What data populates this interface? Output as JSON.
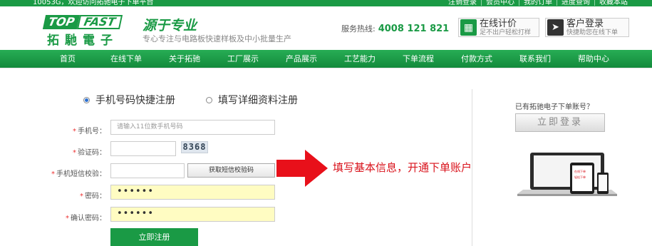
{
  "topbar": {
    "welcome": "10053G，欢迎访问拓驰电子下单平台",
    "links": [
      "注销登录",
      "会员中心",
      "我的订单",
      "进度查询",
      "收藏本站"
    ]
  },
  "header": {
    "logo_top": "TOP",
    "logo_fast": "FAST",
    "logo_cn": "拓馳電子",
    "slogan": "源于专业",
    "tagline": "专心专注与电路板快速样板及中小批量生产",
    "hotline_label": "服务热线:",
    "hotline_number": "4008 121 821",
    "calc_title": "在线计价",
    "calc_sub": "足不出户轻松打样",
    "login_title": "客户登录",
    "login_sub": "快捷助您在线下单",
    "calc_icon": "calculator-icon",
    "login_icon": "cursor-icon"
  },
  "nav": [
    "首页",
    "在线下单",
    "关于拓驰",
    "工厂展示",
    "产品展示",
    "工艺能力",
    "下单流程",
    "付款方式",
    "联系我们",
    "帮助中心"
  ],
  "form": {
    "radio_quick": "手机号码快捷注册",
    "radio_detail": "填写详细资料注册",
    "phone_label": "手机号：",
    "phone_placeholder": "请输入11位数手机号码",
    "code_label": "验证码：",
    "captcha": "8368",
    "sms_label": "手机短信校验：",
    "sms_button": "获取短信校验码",
    "password_label": "密码：",
    "password_value": "••••••",
    "confirm_label": "确认密码：",
    "confirm_value": "••••••",
    "submit": "立即注册"
  },
  "annotation": "填写基本信息，开通下单账户",
  "side": {
    "have_account": "已有拓驰电子下单账号？",
    "login": "立即登录",
    "device_text_1": "在线下单",
    "device_text_2": "轻松下单"
  },
  "colors": {
    "brand_green": "#1a9a45",
    "annotation_red": "#d9121b",
    "input_yellow": "#fffcc2"
  }
}
